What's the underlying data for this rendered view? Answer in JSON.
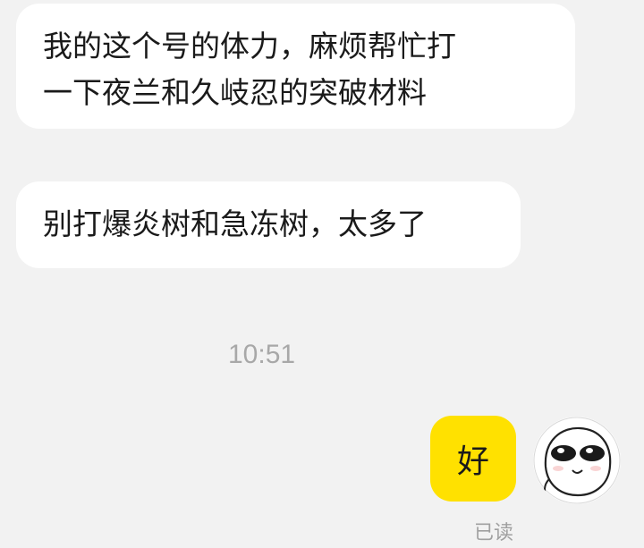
{
  "messages": {
    "incoming": [
      {
        "lines": [
          "我的这个号的体力，麻烦帮忙打",
          "一下夜兰和久岐忍的突破材料"
        ]
      },
      {
        "text": "别打爆炎树和急冻树，太多了"
      }
    ],
    "timestamp": "10:51",
    "outgoing": {
      "text": "好",
      "status": "已读",
      "bubble_color": "#ffe100"
    }
  },
  "avatar": {
    "icon": "cartoon-face-avatar"
  },
  "colors": {
    "background": "#f2f2f2",
    "incoming_bubble": "#ffffff",
    "outgoing_bubble": "#ffe100",
    "timestamp": "#a8a8a8"
  }
}
